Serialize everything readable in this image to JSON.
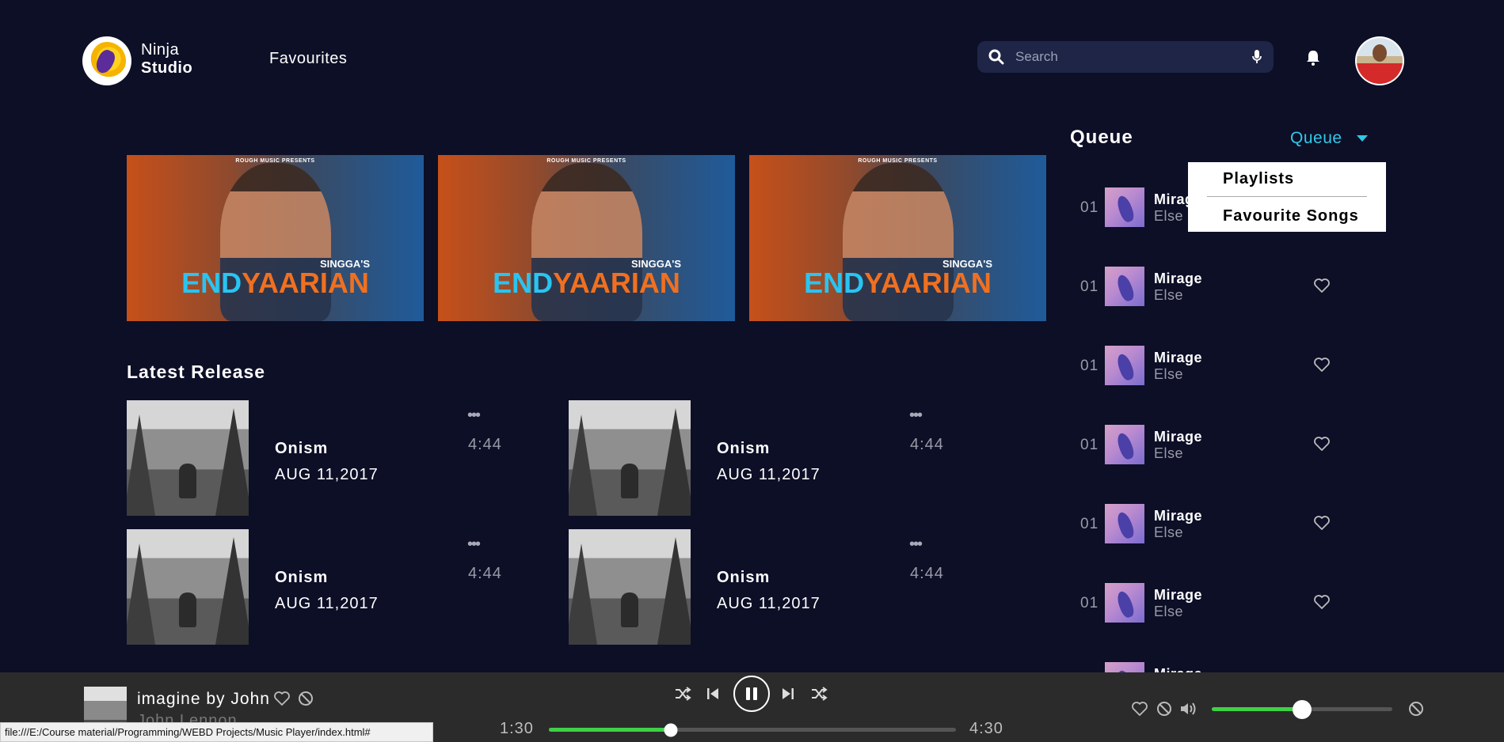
{
  "brand": {
    "line1": "Ninja",
    "line2": "Studio"
  },
  "nav": {
    "favourites": "Favourites"
  },
  "search": {
    "placeholder": "Search"
  },
  "banners": [
    {
      "presents": "ROUGH MUSIC PRESENTS",
      "artist": "SINGGA'S",
      "title_part1": "END",
      "title_part2": "YAARIAN"
    },
    {
      "presents": "ROUGH MUSIC PRESENTS",
      "artist": "SINGGA'S",
      "title_part1": "END",
      "title_part2": "YAARIAN"
    },
    {
      "presents": "ROUGH MUSIC PRESENTS",
      "artist": "SINGGA'S",
      "title_part1": "END",
      "title_part2": "YAARIAN"
    }
  ],
  "latest": {
    "title": "Latest Release",
    "items": [
      {
        "name": "Onism",
        "date": "AUG 11,2017",
        "duration": "4:44",
        "menu": "•••"
      },
      {
        "name": "Onism",
        "date": "AUG 11,2017",
        "duration": "4:44",
        "menu": "•••"
      },
      {
        "name": "Onism",
        "date": "AUG 11,2017",
        "duration": "4:44",
        "menu": "•••"
      },
      {
        "name": "Onism",
        "date": "AUG 11,2017",
        "duration": "4:44",
        "menu": "•••"
      }
    ]
  },
  "queue": {
    "title": "Queue",
    "selected": "Queue",
    "dropdown": [
      "Playlists",
      "Favourite Songs"
    ],
    "items": [
      {
        "num": "01",
        "title": "Mirage",
        "subtitle": "Else"
      },
      {
        "num": "01",
        "title": "Mirage",
        "subtitle": "Else"
      },
      {
        "num": "01",
        "title": "Mirage",
        "subtitle": "Else"
      },
      {
        "num": "01",
        "title": "Mirage",
        "subtitle": "Else"
      },
      {
        "num": "01",
        "title": "Mirage",
        "subtitle": "Else"
      },
      {
        "num": "01",
        "title": "Mirage",
        "subtitle": "Else"
      },
      {
        "num": "",
        "title": "Mirage",
        "subtitle": ""
      }
    ]
  },
  "player": {
    "title": "imagine by John",
    "artist": "John Lennon",
    "current_time": "1:30",
    "total_time": "4:30",
    "progress": 0.3,
    "volume": 0.5
  },
  "status_url": "file:///E:/Course material/Programming/WEBD Projects/Music Player/index.html#",
  "colors": {
    "bg": "#0c0f26",
    "accent": "#31c8e8",
    "progress": "#3ed146",
    "player_bg": "#2b2b2b"
  }
}
